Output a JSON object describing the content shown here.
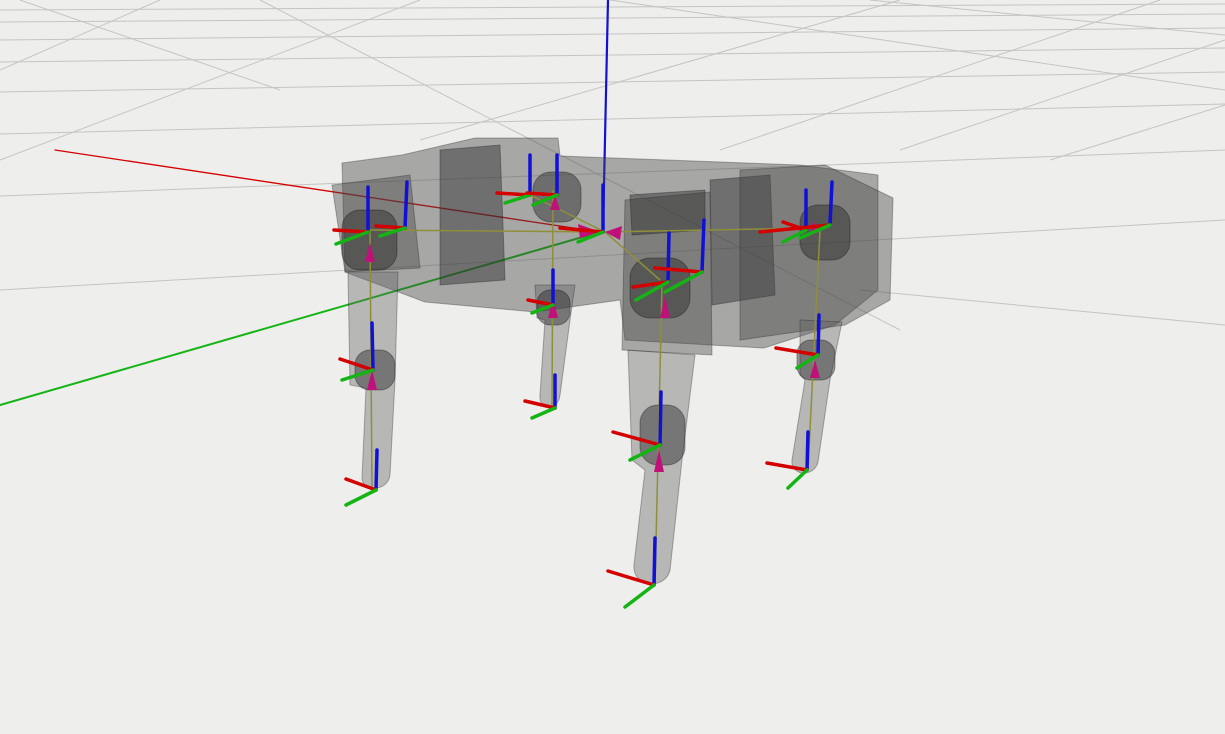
{
  "viewport": {
    "background": "#eeeeec",
    "colors": {
      "x_axis": "#d40000",
      "y_axis": "#13b413",
      "z_axis": "#1010d8",
      "link": "#8f8f3a",
      "joint_arrow": "#c0107a",
      "body": "#464646",
      "grid": "#c4c4c2"
    }
  }
}
